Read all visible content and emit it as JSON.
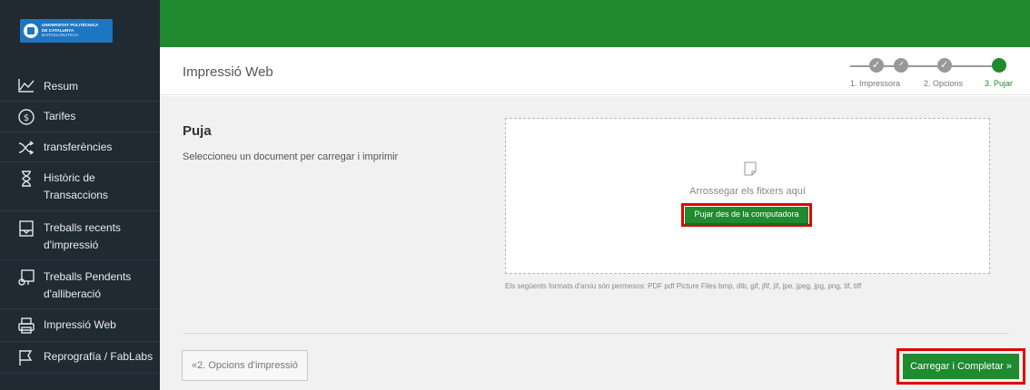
{
  "logo": {
    "line1": "UNIVERSITAT POLITÈCNICA",
    "line2": "DE CATALUNYA",
    "line3": "BARCELONATECH"
  },
  "sidebar": {
    "items": [
      {
        "label_line1": "Resum",
        "label_line2": "",
        "icon": "chart-line-icon"
      },
      {
        "label_line1": "Tarifes",
        "label_line2": "",
        "icon": "dollar-circle-icon"
      },
      {
        "label_line1": "transferències",
        "label_line2": "",
        "icon": "transfer-arrows-icon"
      },
      {
        "label_line1": "Històric de",
        "label_line2": "Transaccions",
        "icon": "hourglass-icon"
      },
      {
        "label_line1": "Treballs recents",
        "label_line2": "d'impressió",
        "icon": "recent-jobs-icon"
      },
      {
        "label_line1": "Treballs Pendents",
        "label_line2": "d'alliberació",
        "icon": "pending-jobs-icon"
      },
      {
        "label_line1": "Impressió Web",
        "label_line2": "",
        "icon": "printer-icon"
      },
      {
        "label_line1": "Reprografía / FabLabs",
        "label_line2": "",
        "icon": "flag-icon"
      }
    ]
  },
  "header": {
    "title": "Impressió Web",
    "steps": [
      {
        "label": "1. Impressora",
        "state": "done"
      },
      {
        "label": "2. Opcions",
        "state": "done"
      },
      {
        "label": "3. Pujar",
        "state": "active"
      }
    ]
  },
  "upload": {
    "title": "Puja",
    "description": "Seleccioneu un document per carregar i imprimir",
    "drop_text": "Arrossegar els fitxers aquí",
    "upload_button": "Pujar des de la computadora",
    "formats": "Els següents formats d'arxiu són permesos: PDF pdf Picture Files bmp, dib, gif, jfif, jif, jpe, jpeg, jpg, png, tif, tiff"
  },
  "actions": {
    "back_label": "«2. Opcions d'impressió",
    "complete_label": "Carregar i Completar »"
  },
  "colors": {
    "brand_green": "#1f8a2e",
    "sidebar_bg": "#1f2a33",
    "highlight_red": "#e00000",
    "logo_blue": "#1e76c2"
  }
}
